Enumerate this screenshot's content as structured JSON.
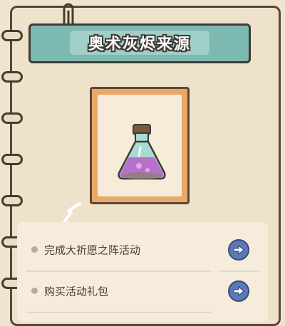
{
  "title": "奥术灰烬来源",
  "item": {
    "icon": "potion-flask-icon"
  },
  "sources": [
    {
      "label": "完成大祈愿之阵活动",
      "action_icon": "arrow-right-icon"
    },
    {
      "label": "购买活动礼包",
      "action_icon": "arrow-right-icon"
    }
  ],
  "colors": {
    "banner": "#7bb9b1",
    "card_frame": "#e9a866",
    "button": "#5b79b9",
    "paper": "#eee2cb"
  }
}
